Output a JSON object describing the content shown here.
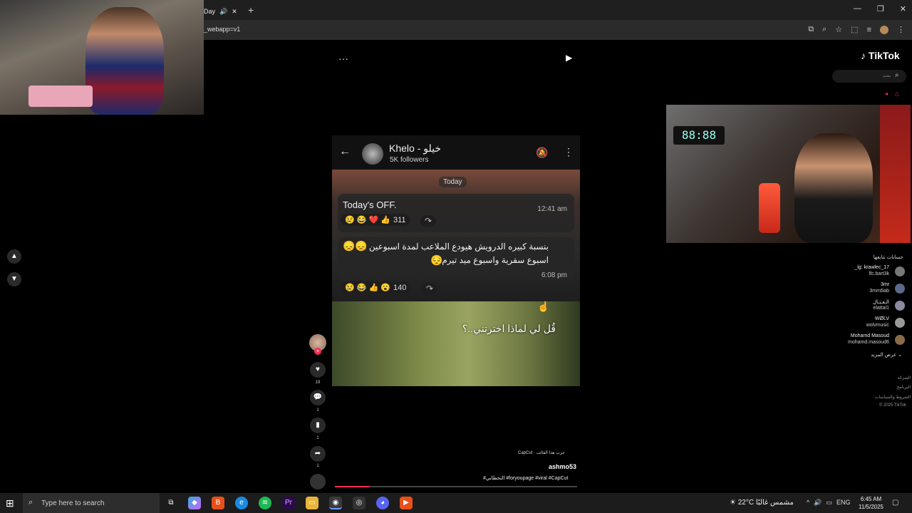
{
  "browser": {
    "tab_label": "Day",
    "url_fragment": "_webapp=v1",
    "new_tab": "+",
    "window_controls": [
      "—",
      "❐",
      "✕"
    ]
  },
  "tiktok": {
    "logo": "TikTok",
    "search_placeholder": "بحث",
    "menu_dots": "···"
  },
  "video": {
    "channel_name": "Khelo - خيلو",
    "followers": "5K followers",
    "date_chip": "Today",
    "msg1_text": "Today's OFF.",
    "msg1_time": "12:41 am",
    "msg1_reactions": "😢 😂 ❤️ 👍",
    "msg1_count": "311",
    "msg2_line1": "بنسبة كبيره الدرويش هيودع الملاعب لمدة اسبوعين ،",
    "msg2_emoji1": "😞😞",
    "msg2_line2": "اسبوع سفرية واسبوع ميد تيرم",
    "msg2_emoji2": "😔",
    "msg2_time": "6:08 pm",
    "msg2_reactions": "😢 😂 👍 😮",
    "msg2_count": "140",
    "clip_caption": "قُل لي لماذا اخترتني..؟"
  },
  "actions": {
    "likes": "19",
    "comments": "1",
    "saves": "1",
    "shares": "1"
  },
  "video_meta": {
    "capcut_tag": "CapCut · جرب هذا القالب",
    "author": "ashmo53",
    "hashtags": "#التحطابي #foryoupage #viral #CapCut"
  },
  "playback": {
    "progress_fraction": 0.14
  },
  "sidebar": {
    "following_title": "حسابات تتابعها",
    "accounts": [
      {
        "name": "_lg: krawlec_17",
        "handle": "lfc.bart3k"
      },
      {
        "name": "3mr",
        "handle": "3mrrdiab"
      },
      {
        "name": "الـعـتـال",
        "handle": "elattal1"
      },
      {
        "name": "WØLV",
        "handle": "wolvmusic"
      },
      {
        "name": "Mohamd Masoud",
        "handle": "mohamd.masoud6"
      }
    ],
    "see_more": "عرض المزيد",
    "footer": [
      "الشركة",
      "البرنامج",
      "الشروط والسياسات",
      "© 2025 TikTok"
    ]
  },
  "taskbar": {
    "search_text": "Type here to search",
    "weather_temp": "22°C",
    "weather_desc": "مشمس غالبًا",
    "lang": "ENG",
    "time": "6:45 AM",
    "date": "11/5/2025"
  },
  "colors": {
    "accent": "#fe2c55",
    "taskbar": "#1c1c1c"
  }
}
